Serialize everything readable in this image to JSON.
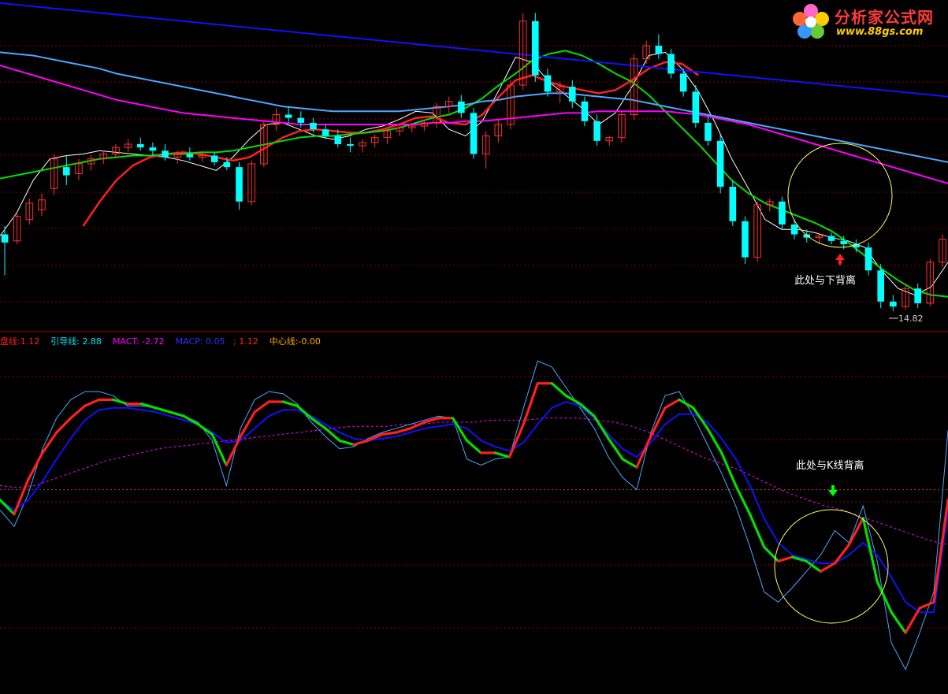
{
  "logo": {
    "title": "分析家公式网",
    "url": "www.88gs.com"
  },
  "legend": {
    "items": [
      {
        "label": "盘线:",
        "value": "1.12",
        "color": "#ff2020"
      },
      {
        "label": "引导线:",
        "value": "2.88",
        "color": "#00e5ff"
      },
      {
        "label": "MACT:",
        "value": "-2.72",
        "color": "#ff00ff"
      },
      {
        "label": "MACP:",
        "value": "0.05",
        "color": "#3030ff"
      },
      {
        "label": ";",
        "value": "1.12",
        "color": "#ff2020"
      },
      {
        "label": "中心线:",
        "value": "-0.00",
        "color": "#ffaa00"
      }
    ]
  },
  "annotations": {
    "top_text": "此处与下背离",
    "bottom_text": "此处与K线背离",
    "low_price": "14.82"
  },
  "colors": {
    "background": "#000000",
    "grid": "#8b0000",
    "up_candle": "#ff3030",
    "down_candle": "#00ffff",
    "ma_white": "#ffffff",
    "ma_red": "#ff2020",
    "ma_green": "#00e000",
    "ma_blue": "#1010ff",
    "ma_cyan": "#4da6ff",
    "ma_magenta": "#ff00ff",
    "circle": "#ffff66",
    "arrow_up": "#ff2020",
    "arrow_down": "#00ff00"
  },
  "chart_data": [
    {
      "type": "candlestick",
      "title": "",
      "candles_ohlc": [
        [
          19.5,
          20.0,
          17.0,
          19.0
        ],
        [
          19.1,
          20.8,
          18.9,
          20.6
        ],
        [
          20.4,
          21.7,
          20.1,
          21.4
        ],
        [
          21.0,
          22.0,
          20.6,
          21.6
        ],
        [
          22.3,
          24.4,
          21.9,
          24.1
        ],
        [
          23.6,
          24.3,
          22.5,
          23.1
        ],
        [
          23.2,
          24.1,
          22.8,
          23.8
        ],
        [
          23.8,
          24.3,
          23.4,
          24.1
        ],
        [
          24.1,
          24.6,
          23.8,
          24.4
        ],
        [
          24.4,
          25.0,
          24.1,
          24.8
        ],
        [
          24.8,
          25.3,
          24.5,
          25.0
        ],
        [
          25.0,
          25.4,
          24.6,
          24.8
        ],
        [
          24.8,
          25.1,
          24.3,
          24.6
        ],
        [
          24.6,
          25.0,
          24.0,
          24.2
        ],
        [
          24.2,
          24.6,
          23.8,
          24.4
        ],
        [
          24.4,
          24.8,
          24.0,
          24.2
        ],
        [
          24.2,
          24.6,
          23.9,
          24.3
        ],
        [
          24.3,
          24.5,
          23.7,
          23.9
        ],
        [
          23.9,
          24.2,
          23.4,
          23.6
        ],
        [
          23.6,
          23.9,
          21.0,
          21.5
        ],
        [
          21.5,
          24.0,
          21.3,
          23.8
        ],
        [
          23.8,
          26.4,
          23.6,
          26.2
        ],
        [
          26.2,
          27.2,
          25.8,
          26.8
        ],
        [
          26.8,
          27.3,
          26.3,
          26.6
        ],
        [
          26.6,
          27.0,
          26.0,
          26.3
        ],
        [
          26.3,
          26.6,
          25.7,
          25.9
        ],
        [
          25.9,
          26.2,
          25.3,
          25.5
        ],
        [
          25.5,
          25.9,
          24.8,
          25.0
        ],
        [
          25.0,
          25.4,
          24.5,
          24.9
        ],
        [
          24.9,
          25.3,
          24.5,
          25.1
        ],
        [
          25.1,
          25.6,
          24.8,
          25.4
        ],
        [
          25.4,
          26.0,
          25.0,
          25.8
        ],
        [
          25.8,
          26.2,
          25.5,
          26.0
        ],
        [
          26.0,
          26.3,
          25.7,
          26.1
        ],
        [
          26.1,
          26.5,
          25.8,
          26.3
        ],
        [
          26.3,
          27.5,
          26.0,
          27.3
        ],
        [
          27.3,
          27.9,
          26.9,
          27.6
        ],
        [
          27.6,
          28.0,
          26.6,
          26.9
        ],
        [
          26.9,
          27.2,
          24.1,
          24.4
        ],
        [
          24.4,
          25.8,
          23.5,
          25.5
        ],
        [
          25.5,
          26.5,
          25.1,
          26.2
        ],
        [
          26.2,
          28.9,
          25.9,
          28.6
        ],
        [
          28.6,
          33.0,
          28.3,
          32.5
        ],
        [
          32.5,
          33.0,
          28.8,
          29.2
        ],
        [
          29.2,
          29.6,
          27.9,
          28.2
        ],
        [
          28.2,
          28.8,
          27.5,
          28.5
        ],
        [
          28.5,
          28.9,
          27.2,
          27.6
        ],
        [
          27.6,
          27.9,
          26.1,
          26.4
        ],
        [
          26.4,
          26.8,
          24.9,
          25.2
        ],
        [
          25.2,
          25.5,
          24.9,
          25.4
        ],
        [
          25.4,
          27.0,
          25.1,
          26.8
        ],
        [
          26.8,
          30.5,
          26.5,
          30.2
        ],
        [
          30.2,
          31.3,
          29.9,
          31.0
        ],
        [
          31.0,
          31.7,
          30.2,
          30.5
        ],
        [
          30.5,
          30.8,
          29.0,
          29.3
        ],
        [
          29.3,
          29.6,
          27.9,
          28.2
        ],
        [
          28.2,
          28.6,
          26.0,
          26.3
        ],
        [
          26.3,
          26.7,
          24.9,
          25.2
        ],
        [
          25.2,
          25.6,
          22.0,
          22.4
        ],
        [
          22.4,
          22.8,
          20.0,
          20.3
        ],
        [
          20.3,
          20.6,
          17.7,
          18.1
        ],
        [
          18.1,
          21.5,
          17.8,
          21.3
        ],
        [
          21.3,
          21.7,
          20.9,
          21.5
        ],
        [
          21.5,
          21.8,
          19.8,
          20.1
        ],
        [
          20.1,
          20.4,
          19.2,
          19.5
        ],
        [
          19.5,
          19.8,
          19.0,
          19.3
        ],
        [
          19.3,
          19.6,
          18.9,
          19.4
        ],
        [
          19.4,
          19.6,
          18.9,
          19.1
        ],
        [
          19.1,
          19.4,
          18.6,
          18.9
        ],
        [
          18.9,
          19.2,
          18.4,
          18.7
        ],
        [
          18.7,
          19.0,
          17.0,
          17.3
        ],
        [
          17.3,
          17.7,
          15.0,
          15.4
        ],
        [
          15.4,
          15.8,
          14.82,
          15.1
        ],
        [
          15.1,
          16.5,
          14.9,
          16.2
        ],
        [
          16.2,
          16.5,
          15.0,
          15.3
        ],
        [
          15.3,
          18.0,
          15.1,
          17.8
        ],
        [
          17.8,
          19.5,
          17.5,
          19.2
        ]
      ],
      "moving_averages": [
        {
          "color": "#ffffff",
          "values": [
            19.4,
            20.8,
            22.8,
            24.1,
            24.3,
            24.4,
            24.6,
            24.5,
            24.4,
            24.3,
            24.2,
            24.0,
            23.7,
            23.4,
            24.2,
            25.3,
            26.2,
            26.3,
            25.9,
            25.5,
            25.3,
            25.5,
            25.9,
            26.1,
            26.5,
            27.0,
            26.9,
            25.9,
            25.5,
            26.4,
            28.3,
            30.3,
            30.0,
            28.8,
            28.0,
            27.2,
            26.2,
            26.9,
            28.5,
            30.4,
            30.6,
            29.6,
            28.2,
            26.3,
            24.1,
            22.3,
            20.4,
            19.8,
            19.8,
            19.6,
            19.3,
            19.1,
            18.7,
            17.3,
            16.2,
            15.8,
            16.3,
            17.8
          ]
        },
        {
          "color": "#ff2020",
          "values": [
            null,
            null,
            null,
            null,
            null,
            20.0,
            21.5,
            22.8,
            23.7,
            24.2,
            24.4,
            24.5,
            24.4,
            24.2,
            24.0,
            24.2,
            24.8,
            25.4,
            25.8,
            25.9,
            25.8,
            25.7,
            25.7,
            25.9,
            26.2,
            26.6,
            26.7,
            26.3,
            26.2,
            26.8,
            27.9,
            28.9,
            29.2,
            28.8,
            28.5,
            28.3,
            28.1,
            28.3,
            28.9,
            29.6,
            30.0,
            29.9,
            29.2,
            null,
            null,
            null,
            null,
            null,
            null,
            null,
            null,
            null,
            null,
            null,
            null,
            null,
            null,
            null
          ]
        },
        {
          "color": "#00e000",
          "values": [
            22.9,
            23.1,
            23.3,
            23.5,
            23.7,
            23.9,
            24.1,
            24.2,
            24.3,
            24.3,
            24.4,
            24.4,
            24.5,
            24.5,
            24.6,
            24.8,
            25.0,
            25.2,
            25.4,
            25.5,
            25.5,
            25.6,
            25.7,
            25.8,
            26.0,
            26.3,
            26.6,
            26.8,
            27.2,
            27.8,
            28.6,
            29.3,
            30.1,
            30.5,
            30.7,
            30.4,
            29.9,
            29.3,
            28.8,
            28.0,
            27.0,
            26.0,
            25.0,
            23.9,
            22.8,
            22.0,
            21.4,
            21.0,
            20.6,
            20.2,
            19.7,
            19.0,
            18.2,
            17.4,
            16.7,
            16.1,
            15.8,
            15.7
          ]
        },
        {
          "color": "#1010ff",
          "values": [
            33.6,
            33.5,
            33.4,
            33.3,
            33.2,
            33.1,
            33.0,
            32.9,
            32.8,
            32.7,
            32.6,
            32.5,
            32.4,
            32.3,
            32.2,
            32.1,
            32.0,
            31.9,
            31.8,
            31.7,
            31.6,
            31.5,
            31.4,
            31.3,
            31.2,
            31.1,
            31.0,
            30.9,
            30.8,
            30.7,
            30.6,
            30.5,
            30.4,
            30.3,
            30.2,
            30.1,
            30.0,
            29.9,
            29.8,
            29.7,
            29.6,
            29.5,
            29.4,
            29.3,
            29.2,
            29.1,
            29.0,
            28.9,
            28.8,
            28.7,
            28.6,
            28.5,
            28.4,
            28.3,
            28.2,
            28.1,
            28.0,
            27.9
          ]
        },
        {
          "color": "#4da6ff",
          "values": [
            30.6,
            30.5,
            30.4,
            30.2,
            30.0,
            29.8,
            29.6,
            29.3,
            29.1,
            28.9,
            28.7,
            28.5,
            28.3,
            28.1,
            27.9,
            27.7,
            27.5,
            27.3,
            27.2,
            27.1,
            27.0,
            27.0,
            27.0,
            27.0,
            27.0,
            27.1,
            27.2,
            27.3,
            27.4,
            27.6,
            27.7,
            27.9,
            28.0,
            28.1,
            28.1,
            28.0,
            27.9,
            27.8,
            27.7,
            27.5,
            27.3,
            27.1,
            26.9,
            26.7,
            26.5,
            26.3,
            26.1,
            25.9,
            25.7,
            25.5,
            25.3,
            25.1,
            24.9,
            24.7,
            24.5,
            24.3,
            24.1,
            23.9
          ]
        },
        {
          "color": "#ff00ff",
          "values": [
            29.8,
            29.5,
            29.2,
            28.9,
            28.6,
            28.3,
            28.0,
            27.7,
            27.5,
            27.3,
            27.1,
            26.9,
            26.8,
            26.7,
            26.6,
            26.5,
            26.4,
            26.3,
            26.2,
            26.2,
            26.2,
            26.2,
            26.2,
            26.2,
            26.2,
            26.2,
            26.3,
            26.3,
            26.4,
            26.4,
            26.5,
            26.6,
            26.7,
            26.8,
            26.9,
            26.9,
            27.0,
            27.0,
            27.0,
            27.0,
            27.0,
            26.9,
            26.8,
            26.6,
            26.4,
            26.2,
            25.9,
            25.6,
            25.3,
            25.0,
            24.7,
            24.4,
            24.1,
            23.8,
            23.5,
            23.2,
            22.9,
            22.6
          ]
        }
      ],
      "low_price_label": "14.82",
      "ylim": [
        14.0,
        33.5
      ]
    },
    {
      "type": "line",
      "title": "",
      "series": [
        {
          "name": "盘线",
          "color_up": "#ff2020",
          "color_down": "#00e000",
          "values": [
            -0.5,
            -1.2,
            0.5,
            1.8,
            2.8,
            3.5,
            4.1,
            4.4,
            4.4,
            4.2,
            4.2,
            4.0,
            3.8,
            3.6,
            3.2,
            2.7,
            1.2,
            2.6,
            3.8,
            4.3,
            4.3,
            4.1,
            3.5,
            3.0,
            2.4,
            2.2,
            2.4,
            2.7,
            2.8,
            3.0,
            3.3,
            3.5,
            3.5,
            2.4,
            1.8,
            1.8,
            1.6,
            3.2,
            5.2,
            5.2,
            4.6,
            4.2,
            3.6,
            2.5,
            1.5,
            1.1,
            2.6,
            4.0,
            4.4,
            4.0,
            3.0,
            1.8,
            0.2,
            -1.2,
            -2.8,
            -3.5,
            -3.3,
            -3.5,
            -4.0,
            -3.6,
            -2.7,
            -1.4,
            -4.5,
            -6.0,
            -7.0,
            -5.8,
            -5.5,
            -0.5
          ]
        },
        {
          "name": "引导线",
          "color": "#4da6ff",
          "values": [
            -1.0,
            -1.8,
            -0.2,
            2.0,
            3.5,
            4.4,
            4.8,
            4.8,
            4.6,
            4.1,
            4.1,
            4.0,
            3.8,
            3.6,
            3.3,
            2.4,
            0.2,
            3.0,
            4.4,
            4.8,
            4.7,
            4.2,
            3.3,
            2.6,
            2.0,
            2.1,
            2.5,
            2.8,
            3.0,
            3.2,
            3.4,
            3.6,
            3.5,
            1.5,
            1.2,
            1.5,
            1.6,
            4.0,
            6.3,
            6.0,
            5.0,
            4.0,
            3.0,
            1.6,
            0.6,
            0.0,
            2.8,
            4.6,
            4.8,
            3.6,
            2.2,
            0.8,
            -0.8,
            -2.8,
            -5.0,
            -5.5,
            -4.8,
            -4.0,
            -3.2,
            -2.0,
            -2.6,
            -0.8,
            -3.5,
            -7.5,
            -8.8,
            -7.0,
            -5.0,
            2.9
          ]
        },
        {
          "name": "MACP",
          "color": "#1010ff",
          "values": [
            -0.5,
            -1.0,
            -0.5,
            0.4,
            1.5,
            2.5,
            3.4,
            3.9,
            4.0,
            4.0,
            3.9,
            3.8,
            3.6,
            3.4,
            3.2,
            2.8,
            2.3,
            2.4,
            3.0,
            3.6,
            3.9,
            3.9,
            3.6,
            3.2,
            2.8,
            2.5,
            2.4,
            2.5,
            2.6,
            2.8,
            3.0,
            3.1,
            3.2,
            3.0,
            2.4,
            2.1,
            1.9,
            2.3,
            3.2,
            4.0,
            4.3,
            4.1,
            3.5,
            2.7,
            2.0,
            1.6,
            2.3,
            3.2,
            3.7,
            3.7,
            3.3,
            2.5,
            1.5,
            0.2,
            -1.4,
            -2.6,
            -3.2,
            -3.4,
            -3.6,
            -3.6,
            -3.2,
            -2.6,
            -3.2,
            -4.3,
            -5.5,
            -6.0,
            -6.0,
            -1.0
          ]
        },
        {
          "name": "MACT",
          "color": "#ff00ff",
          "values": [
            0.2,
            0.1,
            0.2,
            0.5,
            0.8,
            1.1,
            1.4,
            1.6,
            1.8,
            2.0,
            2.1,
            2.2,
            2.3,
            2.4,
            2.5,
            2.6,
            2.7,
            2.8,
            2.9,
            3.0,
            3.1,
            3.1,
            3.1,
            3.2,
            3.2,
            3.3,
            3.3,
            3.3,
            3.4,
            3.4,
            3.4,
            3.5,
            3.5,
            3.5,
            3.4,
            3.3,
            3.1,
            2.8,
            2.4,
            2.0,
            1.6,
            1.3,
            1.0,
            0.6,
            0.2,
            -0.2,
            -0.5,
            -0.8,
            -1.0,
            -1.3,
            -1.6,
            -1.9,
            -2.2,
            -2.5,
            -2.7
          ]
        },
        {
          "name": "中心线",
          "color": "#ffaa00",
          "values": [
            0,
            0
          ]
        }
      ],
      "ylim": [
        -10,
        7
      ]
    }
  ]
}
